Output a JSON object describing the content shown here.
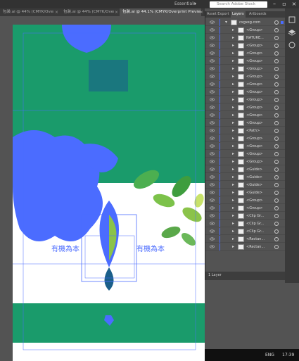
{
  "app": {
    "workspace": "Essentials",
    "search_placeholder": "Search Adobe Stock"
  },
  "tabs": [
    {
      "label": "包装.ai @ 44% (CMYK/Overpri...",
      "active": false
    },
    {
      "label": "包装.ai @ 44% (CMYK/Overp...",
      "active": false
    },
    {
      "label": "包装.ai @ 44.1% (CMYK/Overprint Preview)",
      "active": true
    }
  ],
  "artwork": {
    "green": "#1a9b6b",
    "selection_blue": "#4b6cff",
    "brand_text": "有機為本",
    "left_text": "有機為本"
  },
  "layers_panel": {
    "tabs": [
      "Asset Export",
      "Layers",
      "Artboards"
    ],
    "active_tab": "Layers",
    "top_layer": "cxgxeg.com",
    "rows": [
      "<Group>",
      "NATURE...",
      "<Group>",
      "<Group>",
      "<Group>",
      "<Group>",
      "<Group>",
      "<Group>",
      "<Group>",
      "<Group>",
      "<Group>",
      "<Group>",
      "<Group>",
      "<Path>",
      "<Group>",
      "<Group>",
      "<Group>",
      "<Group>",
      "<Guide>",
      "<Guide>",
      "<Guide>",
      "<Guide>",
      "<Group>",
      "<Group>",
      "<Clip Gr...",
      "<Clip Gr...",
      "<Clip Gr...",
      "<Rectan...",
      "<Rectan..."
    ],
    "footer": "1 Layer"
  },
  "taskbar": {
    "language": "ENG",
    "time": "17:39"
  }
}
